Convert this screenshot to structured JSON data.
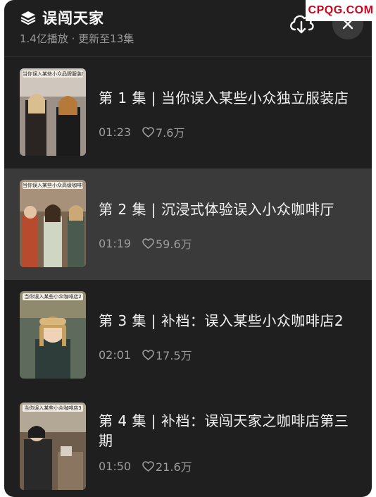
{
  "header": {
    "title": "误闯天家",
    "subtitle": "1.4亿播放 · 更新至13集",
    "icons": {
      "playlist": "stack-icon",
      "download": "cloud-download-icon",
      "close": "close-icon"
    }
  },
  "watermark": "CPQG.COM",
  "episodes": [
    {
      "title": "第 1 集 | 当你误入某些小众独立服装店",
      "duration": "01:23",
      "likes": "7.6万",
      "thumb_caption": "当你误入某些小众品牌服装店",
      "active": false
    },
    {
      "title": "第 2 集 | 沉浸式体验误入小众咖啡厅",
      "duration": "01:19",
      "likes": "59.6万",
      "thumb_caption": "当你误入某些小众高级咖啡厅",
      "active": true
    },
    {
      "title": "第 3 集 | 补档：误入某些小众咖啡店2",
      "duration": "02:01",
      "likes": "17.5万",
      "thumb_caption": "当你误入某些小众咖啡店2",
      "active": false
    },
    {
      "title": "第 4 集 | 补档：误闯天家之咖啡店第三期",
      "duration": "01:50",
      "likes": "21.6万",
      "thumb_caption": "当你误入某些小众咖啡店3",
      "active": false
    }
  ],
  "colors": {
    "panel_bg": "#1f1f1f",
    "active_row_bg": "#3a3a3a",
    "text_primary": "#f2f2f2",
    "text_secondary": "#9c9c9c",
    "watermark_red": "#d0021b"
  }
}
